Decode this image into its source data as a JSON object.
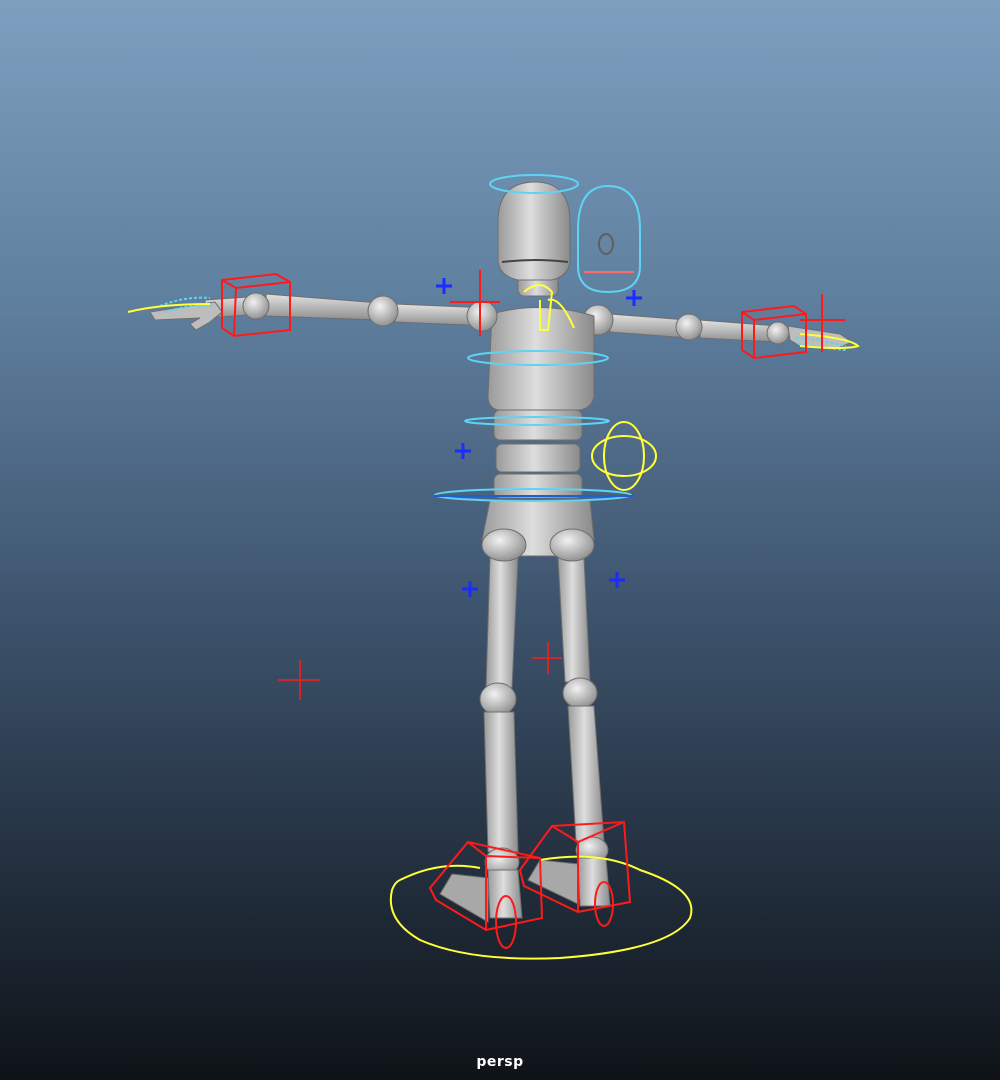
{
  "viewport": {
    "camera_label": "persp",
    "background_top_color": "#7e9fbf",
    "background_bottom_color": "#0f1318"
  },
  "colors": {
    "mesh": "#c9c9c9",
    "mesh_shadow": "#8e8e8e",
    "fk_control": "#5fd3f3",
    "ik_control": "#ff1a1a",
    "main_control": "#ffff3a",
    "locator": "#1a2cff"
  },
  "icons": [
    "locator-cross-icon",
    "ik-handle-icon",
    "control-curve-icon"
  ]
}
